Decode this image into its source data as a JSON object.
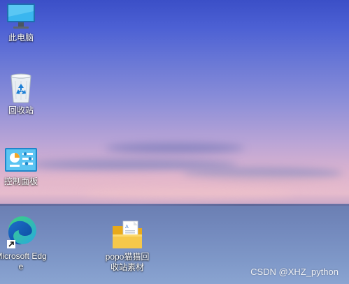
{
  "desktop": {
    "icons": [
      {
        "label": "此电脑",
        "icon": "monitor-icon"
      },
      {
        "label": "回收站",
        "icon": "recycle-bin-icon"
      },
      {
        "label": "控制面板",
        "icon": "control-panel-icon"
      },
      {
        "label": "Microsoft Edge",
        "icon": "edge-icon"
      },
      {
        "label": "popo猫猫回收站素材",
        "icon": "folder-icon"
      }
    ]
  },
  "watermark": {
    "text": "CSDN @XHZ_python"
  }
}
